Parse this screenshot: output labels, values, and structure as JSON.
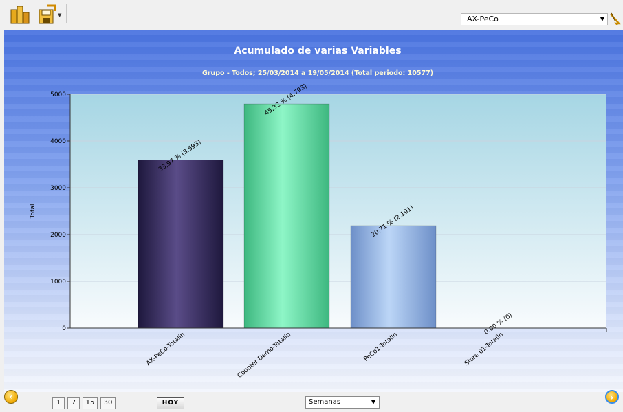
{
  "toolbar": {
    "selected_sensor": "AX-PeCo"
  },
  "chart_data": {
    "type": "bar",
    "title": "Acumulado de varias Variables",
    "subtitle": "Grupo - Todos; 25/03/2014 a 19/05/2014 (Total periodo: 10577)",
    "ylabel": "Total",
    "xlabel": "",
    "ylim": [
      0,
      5000
    ],
    "yticks": [
      0,
      1000,
      2000,
      3000,
      4000,
      5000
    ],
    "grid": true,
    "categories": [
      "AX-PeCo-TotalIn",
      "Counter Demo-TotalIn",
      "PeCo1-TotalIn",
      "Store 01-TotalIn"
    ],
    "values": [
      3593,
      4793,
      2191,
      0
    ],
    "data_labels": [
      "33,97 % (3.593)",
      "45,32 % (4.793)",
      "20,71 % (2.191)",
      "0,00 % (0)"
    ],
    "colors": [
      "#2d2554",
      "#4fd39a",
      "#8eaee0",
      "#cccccc"
    ]
  },
  "bottom": {
    "prev_icon": "arrow-left-icon",
    "next_icon": "arrow-right-icon",
    "range_buttons": [
      "1",
      "7",
      "15",
      "30"
    ],
    "today_label": "HOY",
    "period_value": "Semanas"
  }
}
